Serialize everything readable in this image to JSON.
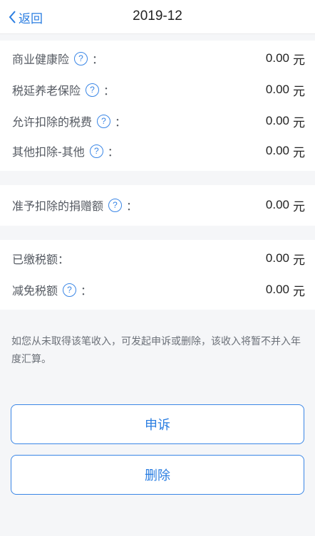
{
  "header": {
    "back_label": "返回",
    "title": "2019-12"
  },
  "section_deductions": {
    "rows": [
      {
        "label": "商业健康险",
        "has_help": true,
        "colon": "：",
        "value": "0.00",
        "unit": "元"
      },
      {
        "label": "税延养老保险",
        "has_help": true,
        "colon": "：",
        "value": "0.00",
        "unit": "元"
      },
      {
        "label": "允许扣除的税费",
        "has_help": true,
        "colon": "：",
        "value": "0.00",
        "unit": "元"
      },
      {
        "label": "其他扣除-其他",
        "has_help": true,
        "colon": "：",
        "value": "0.00",
        "unit": "元"
      }
    ]
  },
  "section_donation": {
    "rows": [
      {
        "label": "准予扣除的捐赠额",
        "has_help": true,
        "colon": "：",
        "value": "0.00",
        "unit": "元"
      }
    ]
  },
  "section_tax": {
    "rows": [
      {
        "label": "已缴税额：",
        "value": "0.00",
        "unit": "元"
      },
      {
        "label": "减免税额",
        "has_help": true,
        "colon": "：",
        "value": "0.00",
        "unit": "元"
      }
    ]
  },
  "help_icon_glyph": "?",
  "note": "如您从未取得该笔收入，可发起申诉或删除，该收入将暂不并入年度汇算。",
  "buttons": {
    "appeal": "申诉",
    "delete": "删除"
  },
  "colors": {
    "accent": "#2a7de1",
    "page_bg": "#f5f6f8",
    "section_bg": "#ffffff"
  }
}
